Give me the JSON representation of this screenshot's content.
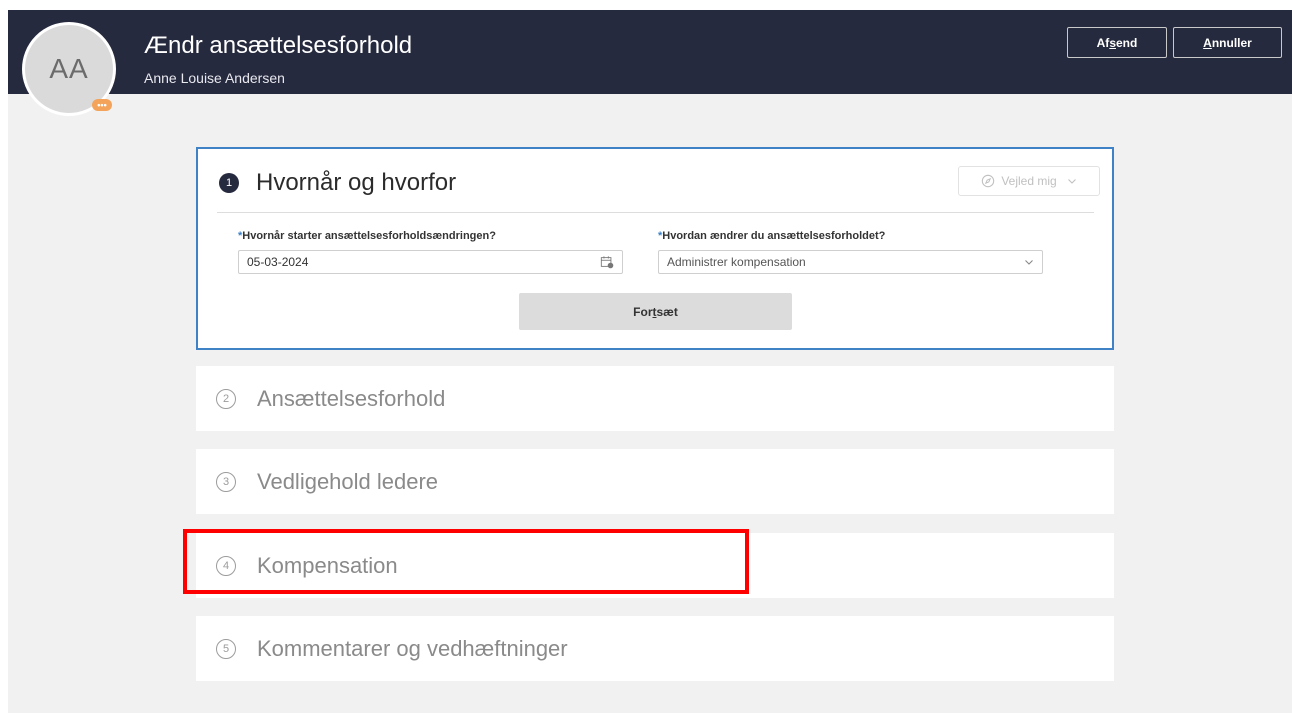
{
  "header": {
    "avatar_initials": "AA",
    "title": "Ændr ansættelsesforhold",
    "subtitle": "Anne Louise Andersen",
    "badge": "•••",
    "submit_prefix": "Af",
    "submit_ul": "s",
    "submit_suffix": "end",
    "cancel_ul": "A",
    "cancel_suffix": "nnuller"
  },
  "steps": [
    {
      "number": "1",
      "title": "Hvornår og hvorfor",
      "guide_label": "Vejled mig",
      "date_required": "*",
      "date_label": "Hvornår starter ansættelsesforholdsændringen?",
      "date_value": "05-03-2024",
      "how_required": "*",
      "how_label": "Hvordan ændrer du ansættelsesforholdet?",
      "how_value": "Administrer kompensation",
      "continue_prefix": "For",
      "continue_ul": "t",
      "continue_suffix": "sæt"
    },
    {
      "number": "2",
      "title": "Ansættelsesforhold"
    },
    {
      "number": "3",
      "title": "Vedligehold ledere"
    },
    {
      "number": "4",
      "title": "Kompensation"
    },
    {
      "number": "5",
      "title": "Kommentarer og vedhæftninger"
    }
  ],
  "colors": {
    "header_bg": "#262a3e",
    "active_border": "#3f82c5",
    "highlight": "#ff0000",
    "required_mark": "#3b7fc4"
  },
  "icons": {
    "date": "calendar-icon",
    "select": "chevron-down-icon",
    "guide": "compass-icon"
  }
}
